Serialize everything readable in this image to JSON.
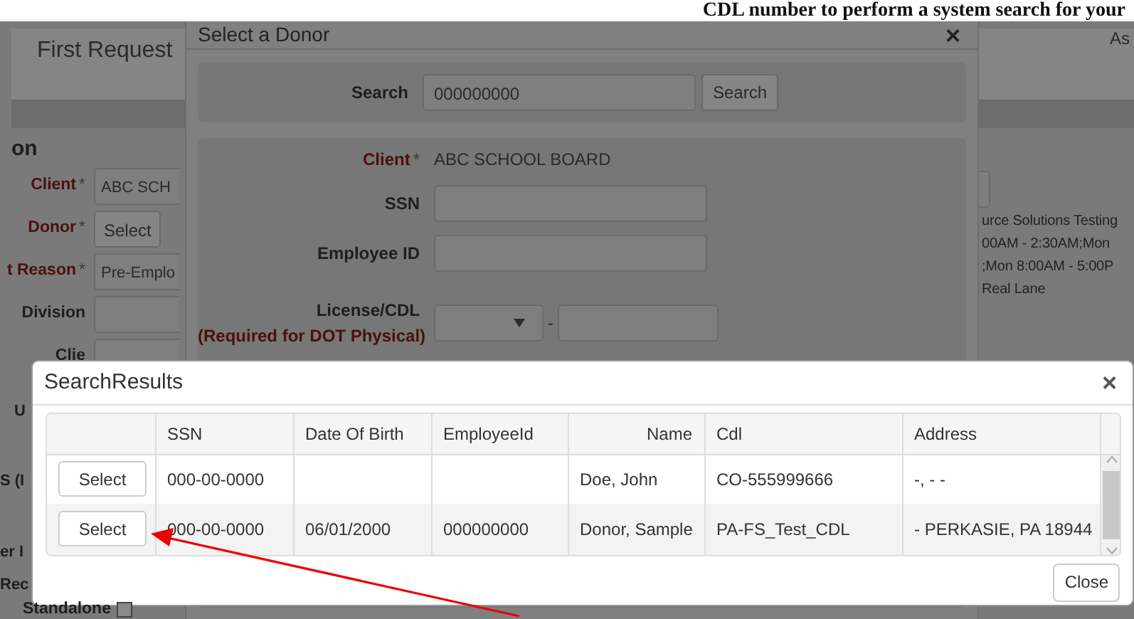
{
  "banner": "CDL number to perform a system search for your",
  "page": {
    "title": "First Request",
    "header_right": "As",
    "section_title": "on",
    "fields": [
      {
        "label": "Client",
        "required": "*",
        "kind": "input",
        "value": "ABC SCH"
      },
      {
        "label": "Donor",
        "required": "*",
        "kind": "button",
        "value": "Select"
      },
      {
        "label": "t Reason",
        "required": "*",
        "kind": "input",
        "value": "Pre-Emplo"
      },
      {
        "label": "Division",
        "kind": "input"
      },
      {
        "label": "Clie",
        "kind": "input"
      }
    ],
    "info_lines": [
      "urce Solutions Testing",
      "00AM - 2:30AM;Mon",
      ";Mon 8:00AM - 5:00P",
      "Real Lane"
    ],
    "lower_labels": [
      "U",
      "S (I",
      "er I",
      "Rec"
    ],
    "standalone": {
      "label": "Standalone",
      "checked": false
    }
  },
  "donor_dialog": {
    "title": "Select a Donor",
    "close": "×",
    "search": {
      "label": "Search",
      "value": "000000000",
      "button": "Search"
    },
    "client": {
      "label": "Client",
      "required": "*",
      "value": "ABC SCHOOL BOARD"
    },
    "fields": [
      {
        "label": "SSN"
      },
      {
        "label": "Employee ID"
      }
    ],
    "license": {
      "label": "License/CDL",
      "note": "(Required for DOT Physical)",
      "separator": "-"
    }
  },
  "results_dialog": {
    "title": "SearchResults",
    "close": "×",
    "columns": [
      "SSN",
      "Date Of Birth",
      "EmployeeId",
      "Name",
      "Cdl",
      "Address"
    ],
    "rows": [
      {
        "action": "Select",
        "cells": [
          "000-00-0000",
          "",
          "",
          "Doe, John",
          "CO-555999666",
          "-, - -"
        ]
      },
      {
        "action": "Select",
        "cells": [
          "000-00-0000",
          "06/01/2000",
          "000000000",
          "Donor, Sample",
          "PA-FS_Test_CDL",
          "- PERKASIE, PA 18944"
        ]
      }
    ],
    "close_button": "Close"
  }
}
